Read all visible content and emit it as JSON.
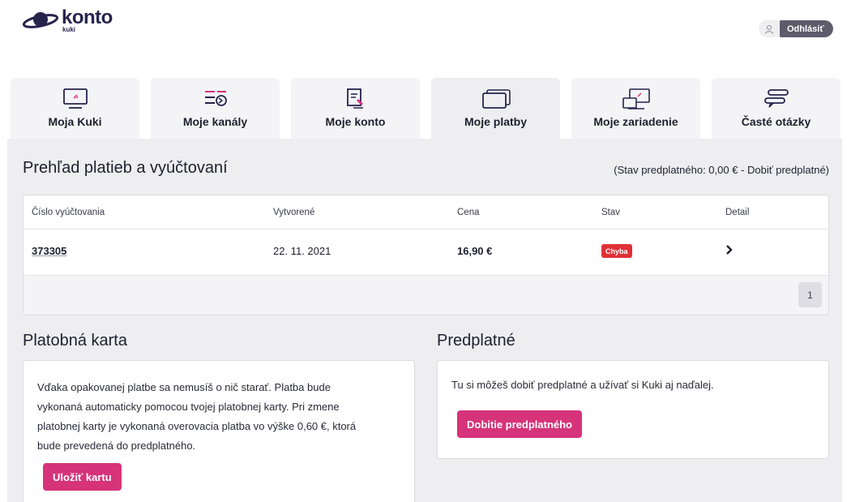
{
  "colors": {
    "brand": "#26234d",
    "accent": "#d6337a",
    "error_badge": "#e03136",
    "logout_bg": "#5e5c6b"
  },
  "header": {
    "logo_word": "konto",
    "logo_sub": "kuki",
    "user_icon": "user-icon",
    "logout_label": "Odhlásiť"
  },
  "tabs": [
    {
      "label": "Moja Kuki",
      "icon": "monitor-icon",
      "active": false
    },
    {
      "label": "Moje kanály",
      "icon": "channel-list-icon",
      "active": false
    },
    {
      "label": "Moje konto",
      "icon": "account-icon",
      "active": false
    },
    {
      "label": "Moje platby",
      "icon": "card-icon",
      "active": true
    },
    {
      "label": "Moje zariadenie",
      "icon": "devices-icon",
      "active": false
    },
    {
      "label": "Časté otázky",
      "icon": "faq-icon",
      "active": false
    }
  ],
  "payments": {
    "title": "Prehľad platieb a vyúčtovaní",
    "subscription_status": "(Stav predplatného: 0,00 € - Dobiť predplatné)",
    "columns": [
      "Číslo vyúčtovania",
      "Vytvorené",
      "Cena",
      "Stav",
      "Detail"
    ],
    "rows": [
      {
        "number": "373305",
        "created": "22. 11. 2021",
        "price": "16,90 €",
        "status": "Chyba",
        "detail_icon": "chevron-right-icon"
      }
    ],
    "page": "1"
  },
  "card_section": {
    "title": "Platobná karta",
    "lines": [
      "Vďaka opakovanej platbe sa nemusíš o nič starať. Platba bude",
      "vykonaná automaticky pomocou tvojej platobnej karty. Pri zmene",
      "platobnej karty je vykonaná overovacia platba vo výške 0,60 €, ktorá",
      "bude prevedená do predplatného."
    ],
    "button": "Uložiť kartu"
  },
  "prepaid_section": {
    "title": "Predplatné",
    "text": "Tu si môžeš dobiť predplatné a užívať si Kuki aj naďalej.",
    "button": "Dobitie predplatného"
  }
}
